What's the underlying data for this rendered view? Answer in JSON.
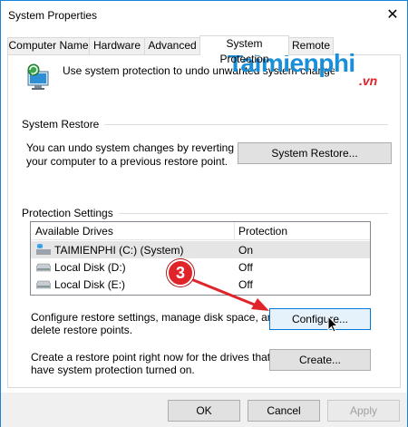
{
  "window": {
    "title": "System Properties",
    "close_label": "✕"
  },
  "tabs": [
    {
      "label": "Computer Name",
      "active": false
    },
    {
      "label": "Hardware",
      "active": false
    },
    {
      "label": "Advanced",
      "active": false
    },
    {
      "label": "System Protection",
      "active": true
    },
    {
      "label": "Remote",
      "active": false
    }
  ],
  "intro": {
    "text": "Use system protection to undo unwanted system changes."
  },
  "watermark": {
    "brand": "Taimienphi",
    "suffix": ".vn"
  },
  "system_restore": {
    "label": "System Restore",
    "description_line1": "You can undo system changes by reverting",
    "description_line2": "your computer to a previous restore point.",
    "button_label": "System Restore..."
  },
  "protection": {
    "label": "Protection Settings",
    "columns": [
      "Available Drives",
      "Protection"
    ],
    "rows": [
      {
        "drive": "TAIMIENPHI (C:) (System)",
        "protection": "On",
        "system": true
      },
      {
        "drive": "Local Disk (D:)",
        "protection": "Off",
        "system": false
      },
      {
        "drive": "Local Disk (E:)",
        "protection": "Off",
        "system": false
      }
    ],
    "configure_text_line1": "Configure restore settings, manage disk space, and",
    "configure_text_line2": "delete restore points.",
    "configure_button": "Configure...",
    "create_text_line1": "Create a restore point right now for the drives that",
    "create_text_line2": "have system protection turned on.",
    "create_button": "Create..."
  },
  "annotation": {
    "step": "3"
  },
  "footer": {
    "ok": "OK",
    "cancel": "Cancel",
    "apply": "Apply"
  },
  "colors": {
    "accent": "#0078d7",
    "badge": "#e1242a",
    "arrow": "#e1242a",
    "watermark_blue": "#1a8fd9",
    "watermark_red": "#e41f26"
  }
}
